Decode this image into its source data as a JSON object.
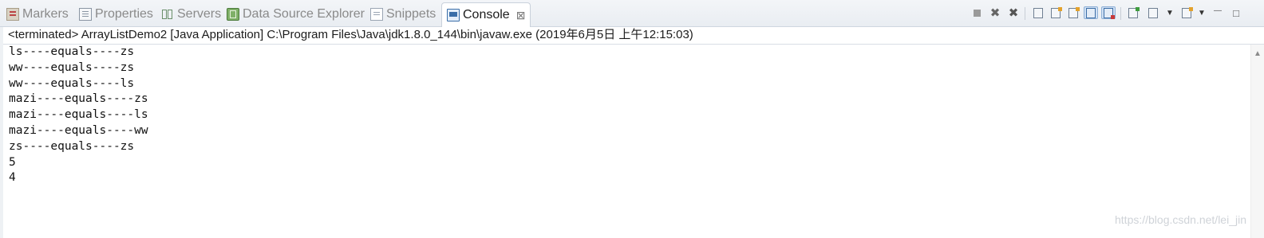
{
  "tabs": [
    {
      "label": "Markers",
      "icon": "markers-icon"
    },
    {
      "label": "Properties",
      "icon": "properties-icon"
    },
    {
      "label": "Servers",
      "icon": "servers-icon"
    },
    {
      "label": "Data Source Explorer",
      "icon": "data-source-explorer-icon"
    },
    {
      "label": "Snippets",
      "icon": "snippets-icon"
    },
    {
      "label": "Console",
      "icon": "console-icon",
      "active": true
    }
  ],
  "tab_close_glyph": "⊠",
  "toolbar": {
    "terminate_icon": "terminate-icon",
    "remove_launch_glyph": "✖",
    "remove_all_glyph": "✖",
    "caret_glyph": "▼",
    "minimize_glyph": "—",
    "maximize_glyph": "□"
  },
  "console": {
    "status": "<terminated> ArrayListDemo2 [Java Application] C:\\Program Files\\Java\\jdk1.8.0_144\\bin\\javaw.exe (2019年6月5日 上午12:15:03)",
    "lines": [
      "ls----equals----zs",
      "ww----equals----zs",
      "ww----equals----ls",
      "mazi----equals----zs",
      "mazi----equals----ls",
      "mazi----equals----ww",
      "zs----equals----zs",
      "5",
      "4"
    ]
  },
  "scrollbar": {
    "up_glyph": "▲"
  },
  "watermark": "https://blog.csdn.net/lei_jin",
  "colors": {
    "tab_bar": "#e9edf2",
    "active_tab": "#ffffff",
    "text": "#1b1b1b",
    "inactive_tab_text": "#8a8a8a",
    "pressed_tool": "#cfe0f4"
  }
}
